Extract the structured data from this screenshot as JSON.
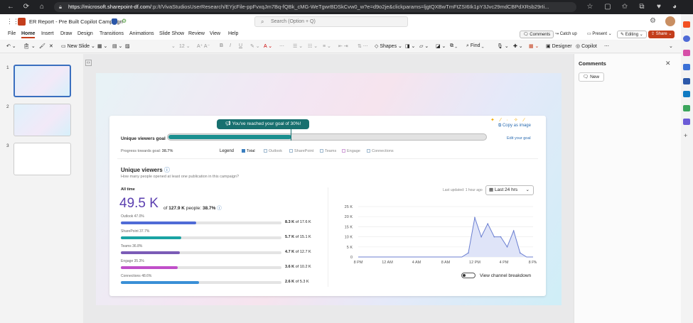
{
  "browser": {
    "url_host": "https://microsoft.sharepoint-df.com/",
    "url_path": ":p:/t/VivaStudiosUserResearch/EYjcFile-ppFvxqJm7Bq-fQBk_cMG-WeTgwrBDSkCvw0_w?e=d9o2je&clickparams=ljgtQXBwTmFtZSI6Ik1pY3Jvc29mdCBPdXRsb29rIi..."
  },
  "app": {
    "doc_title": "ER Report - Pre Built Copilot Campaign",
    "search_placeholder": "Search (Option + Q)",
    "ribbon_tabs": [
      "File",
      "Home",
      "Insert",
      "Draw",
      "Design",
      "Transitions",
      "Animations",
      "Slide Show",
      "Review",
      "View",
      "Help"
    ],
    "active_tab": "Home",
    "buttons": {
      "comments": "Comments",
      "catchup": "Catch up",
      "present": "Present",
      "editing": "Editing",
      "share": "Share"
    },
    "toolbar": {
      "new_slide": "New Slide",
      "font_size": "12",
      "shapes": "Shapes",
      "find": "Find",
      "designer": "Designer",
      "copilot": "Copilot"
    }
  },
  "thumbnails": [
    "1",
    "2",
    "3"
  ],
  "comments_pane": {
    "title": "Comments",
    "new_label": "New"
  },
  "goal": {
    "label": "Unique viewers goal",
    "banner": "You've reached your goal of 30%!",
    "progress_label": "Progress towards goal:",
    "progress_value": "38.7%",
    "progress": 0.387,
    "goal": 0.3,
    "copy_image": "Copy as image",
    "edit_goal": "Edit your goal"
  },
  "legend": {
    "title": "Legend",
    "items": [
      "Total",
      "Outlook",
      "SharePoint",
      "Teams",
      "Engage",
      "Connections"
    ]
  },
  "viewers": {
    "title": "Unique viewers",
    "subtitle": "How many people opened at least one publication in this campaign?",
    "all_time": "All time",
    "big_value": "49.5 K",
    "of_text": "of",
    "total": "127.9 K",
    "people_text": "people:",
    "pct": "38.7%"
  },
  "channels": [
    {
      "name": "Outlook",
      "pct": "47.0%",
      "value": "8.3 K",
      "total": "17.6 K",
      "fraction": 0.47,
      "color": "#4f6bd6"
    },
    {
      "name": "SharePoint",
      "pct": "37.7%",
      "value": "5.7 K",
      "total": "15.1 K",
      "fraction": 0.377,
      "color": "#1aa3a3"
    },
    {
      "name": "Teams",
      "pct": "36.8%",
      "value": "4.7 K",
      "total": "12.7 K",
      "fraction": 0.368,
      "color": "#7b5bb6"
    },
    {
      "name": "Engage",
      "pct": "35.3%",
      "value": "3.6 K",
      "total": "10.2 K",
      "fraction": 0.353,
      "color": "#c04fc9"
    },
    {
      "name": "Connections",
      "pct": "48.6%",
      "value": "2.6 K",
      "total": "5.3 K",
      "fraction": 0.486,
      "color": "#3a8fd6"
    }
  ],
  "timeline": {
    "updated": "Last updated: 1 hour ago",
    "range": "Last 24 hrs",
    "toggle_label": "View channel breakdown"
  },
  "chart_data": {
    "type": "area",
    "x": [
      "8 PM",
      "",
      "12 AM",
      "",
      "4 AM",
      "",
      "8 AM",
      "",
      "12 PM",
      "",
      "4 PM",
      "",
      "8 PM"
    ],
    "x_tick_labels": [
      "8 PM",
      "12 AM",
      "4 AM",
      "8 AM",
      "12 PM",
      "4 PM",
      "8 PM"
    ],
    "y_tick_labels": [
      "25 K",
      "20 K",
      "15 K",
      "10 K",
      "5 K",
      "0"
    ],
    "ylim": [
      0,
      25000
    ],
    "points": [
      [
        0,
        0
      ],
      [
        1,
        0
      ],
      [
        2,
        0
      ],
      [
        3,
        0
      ],
      [
        4,
        0
      ],
      [
        5,
        0
      ],
      [
        6,
        0
      ],
      [
        7,
        0
      ],
      [
        8,
        0
      ],
      [
        9,
        0
      ],
      [
        10,
        0
      ],
      [
        11,
        0
      ],
      [
        12,
        0
      ],
      [
        13,
        0
      ],
      [
        14,
        0
      ],
      [
        15,
        0
      ],
      [
        16,
        0
      ],
      [
        17,
        2000
      ],
      [
        18,
        19500
      ],
      [
        19,
        10000
      ],
      [
        20,
        16500
      ],
      [
        21,
        10000
      ],
      [
        22,
        10000
      ],
      [
        23,
        5000
      ],
      [
        24,
        13000
      ],
      [
        25,
        2000
      ],
      [
        26,
        0
      ],
      [
        27,
        0
      ]
    ],
    "x_max": 27,
    "grid": true,
    "color": "#6b7fd1"
  },
  "colors": {
    "accent": "#c43e1c",
    "teal": "#1a8f8f",
    "banner": "#18706f"
  }
}
